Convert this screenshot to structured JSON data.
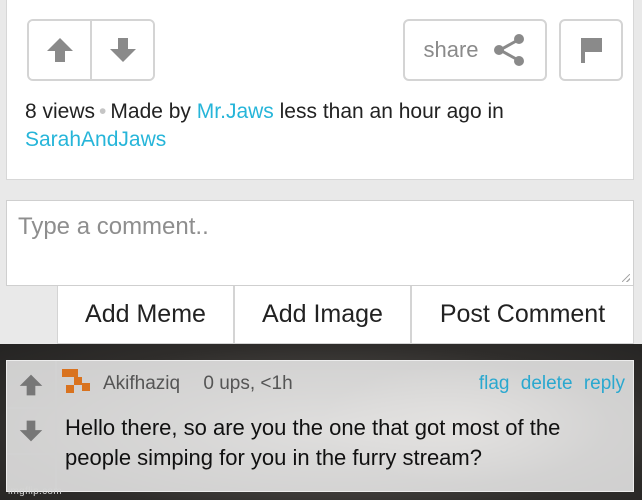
{
  "post": {
    "share_label": "share",
    "views": "8 views",
    "dot": "•",
    "made_by": "Made by",
    "author": "Mr.Jaws",
    "time_text": "less than an hour ago in",
    "stream": "SarahAndJaws"
  },
  "composer": {
    "placeholder": "Type a comment..",
    "add_meme": "Add Meme",
    "add_image": "Add Image",
    "post_comment": "Post Comment"
  },
  "comment": {
    "username": "Akifhaziq",
    "meta": "0 ups, <1h",
    "flag": "flag",
    "delete": "delete",
    "reply": "reply",
    "text": "Hello there, so are you the one that got most of the people simping for you in the furry stream?"
  },
  "watermark": "imgflip.com",
  "colors": {
    "link": "#26b5d9",
    "icon_gray": "#8a8a8a",
    "avatar": "#d9731f"
  }
}
